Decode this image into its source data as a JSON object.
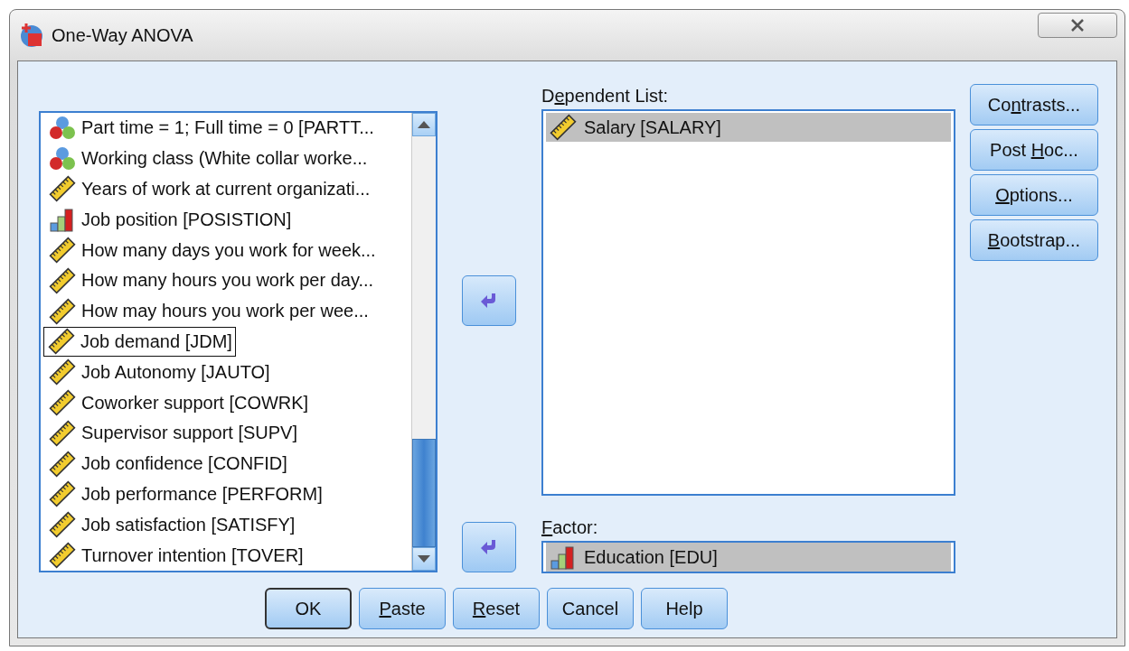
{
  "window": {
    "title": "One-Way ANOVA"
  },
  "variables": [
    {
      "label": "Part time = 1; Full time = 0 [PARTT...",
      "kind": "nominal",
      "focused": false
    },
    {
      "label": "Working class (White collar worke...",
      "kind": "nominal",
      "focused": false
    },
    {
      "label": "Years of work at current organizati...",
      "kind": "scale",
      "focused": false
    },
    {
      "label": "Job position [POSISTION]",
      "kind": "ordinal",
      "focused": false
    },
    {
      "label": "How many days you work for week...",
      "kind": "scale",
      "focused": false
    },
    {
      "label": "How many hours you work per day...",
      "kind": "scale",
      "focused": false
    },
    {
      "label": "How may hours you work per wee...",
      "kind": "scale",
      "focused": false
    },
    {
      "label": "Job demand [JDM]",
      "kind": "scale",
      "focused": true
    },
    {
      "label": "Job Autonomy [JAUTO]",
      "kind": "scale",
      "focused": false
    },
    {
      "label": "Coworker support [COWRK]",
      "kind": "scale",
      "focused": false
    },
    {
      "label": "Supervisor support [SUPV]",
      "kind": "scale",
      "focused": false
    },
    {
      "label": "Job confidence [CONFID]",
      "kind": "scale",
      "focused": false
    },
    {
      "label": "Job performance [PERFORM]",
      "kind": "scale",
      "focused": false
    },
    {
      "label": "Job satisfaction [SATISFY]",
      "kind": "scale",
      "focused": false
    },
    {
      "label": "Turnover intention [TOVER]",
      "kind": "scale",
      "focused": false
    }
  ],
  "dependent_list": {
    "label": {
      "before": "D",
      "access_key": "e",
      "after": "pendent List:"
    },
    "items": [
      {
        "label": "Salary [SALARY]",
        "kind": "scale",
        "selected": true
      }
    ]
  },
  "factor": {
    "label": {
      "access_key": "F",
      "after": "actor:"
    },
    "items": [
      {
        "label": "Education [EDU]",
        "kind": "ordinal",
        "selected": true
      }
    ]
  },
  "side_buttons": [
    {
      "label": {
        "before": "Co",
        "access_key": "n",
        "after": "trasts..."
      }
    },
    {
      "label": {
        "before": "Post ",
        "access_key": "H",
        "after": "oc..."
      }
    },
    {
      "label": {
        "access_key": "O",
        "after": "ptions..."
      }
    },
    {
      "label": {
        "access_key": "B",
        "after": "ootstrap..."
      }
    }
  ],
  "bottom_buttons": [
    {
      "label": "OK",
      "default": true
    },
    {
      "label": {
        "access_key": "P",
        "after": "aste"
      },
      "default": false
    },
    {
      "label": {
        "access_key": "R",
        "after": "eset"
      },
      "default": false
    },
    {
      "label": "Cancel",
      "default": false
    },
    {
      "label": "Help",
      "default": false
    }
  ]
}
